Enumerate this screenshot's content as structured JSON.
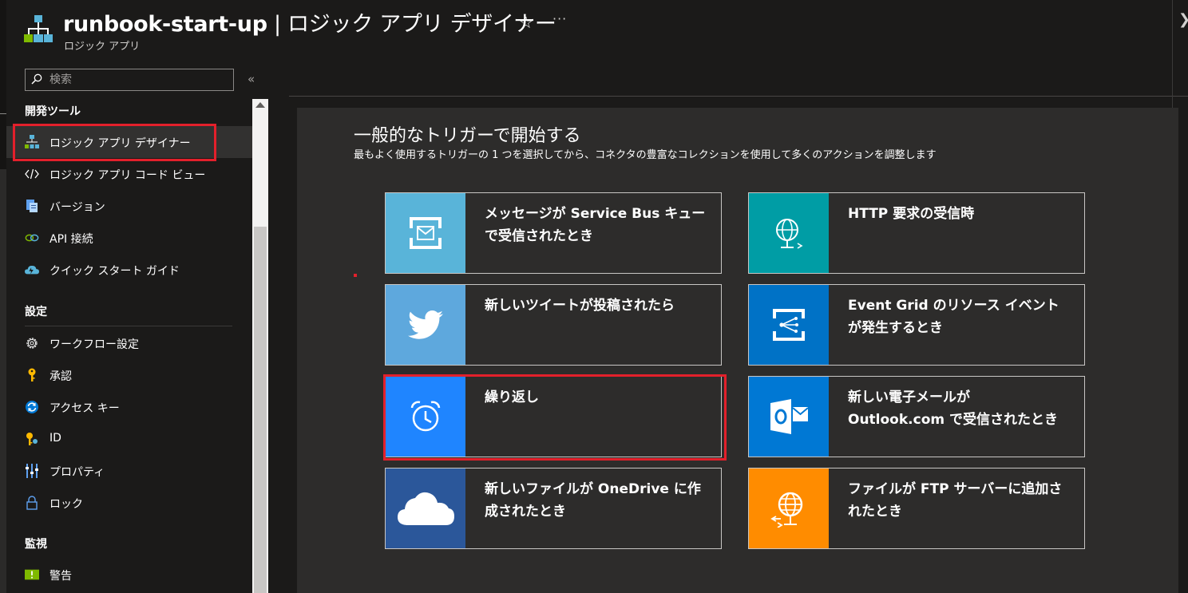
{
  "header": {
    "title_main": "runbook-start-up",
    "title_sep": " | ",
    "title_sub": "ロジック アプリ デザイナー",
    "subtitle": "ロジック アプリ",
    "star_glyph": "☆",
    "more_glyph": "···",
    "close_glyph": "❯"
  },
  "search": {
    "placeholder": "検索",
    "collapse_glyph": "«"
  },
  "sidebar": {
    "sections": [
      {
        "title": "開発ツール",
        "items": [
          {
            "label": "ロジック アプリ デザイナー",
            "icon": "logic-app-designer-icon",
            "active": true
          },
          {
            "label": "ロジック アプリ コード ビュー",
            "icon": "code-view-icon"
          },
          {
            "label": "バージョン",
            "icon": "versions-icon"
          },
          {
            "label": "API 接続",
            "icon": "api-connections-icon"
          },
          {
            "label": "クイック スタート ガイド",
            "icon": "quick-start-icon"
          }
        ]
      },
      {
        "title": "設定",
        "items": [
          {
            "label": "ワークフロー設定",
            "icon": "gear-icon"
          },
          {
            "label": "承認",
            "icon": "key-icon"
          },
          {
            "label": "アクセス キー",
            "icon": "access-keys-icon"
          },
          {
            "label": "ID",
            "icon": "identity-icon"
          },
          {
            "label": "プロパティ",
            "icon": "properties-icon"
          },
          {
            "label": "ロック",
            "icon": "lock-icon"
          }
        ]
      },
      {
        "title": "監視",
        "items": [
          {
            "label": "警告",
            "icon": "alerts-icon"
          }
        ]
      }
    ]
  },
  "main": {
    "title": "一般的なトリガーで開始する",
    "description": "最もよく使用するトリガーの 1 つを選択してから、コネクタの豊富なコレクションを使用して多くのアクションを調整します",
    "triggers": [
      {
        "label": "メッセージが Service Bus キューで受信されたとき",
        "icon": "service-bus-icon",
        "color": "#59b4d9"
      },
      {
        "label": "HTTP 要求の受信時",
        "icon": "http-request-icon",
        "color": "#009da5"
      },
      {
        "label": "新しいツイートが投稿されたら",
        "icon": "twitter-icon",
        "color": "#5ea8dd"
      },
      {
        "label": "Event Grid のリソース イベントが発生するとき",
        "icon": "event-grid-icon",
        "color": "#0072c6"
      },
      {
        "label": "繰り返し",
        "icon": "alarm-clock-icon",
        "color": "#1f85ff"
      },
      {
        "label": "新しい電子メールが Outlook.com で受信されたとき",
        "icon": "outlook-icon",
        "color": "#0078d4"
      },
      {
        "label": "新しいファイルが OneDrive に作成されたとき",
        "icon": "onedrive-icon",
        "color": "#2b579a"
      },
      {
        "label": "ファイルが FTP サーバーに追加されたとき",
        "icon": "ftp-icon",
        "color": "#ff8c00"
      }
    ]
  },
  "colors": {
    "highlight": "#e3202b",
    "background": "#1b1a19",
    "panel": "#2d2c2b"
  }
}
